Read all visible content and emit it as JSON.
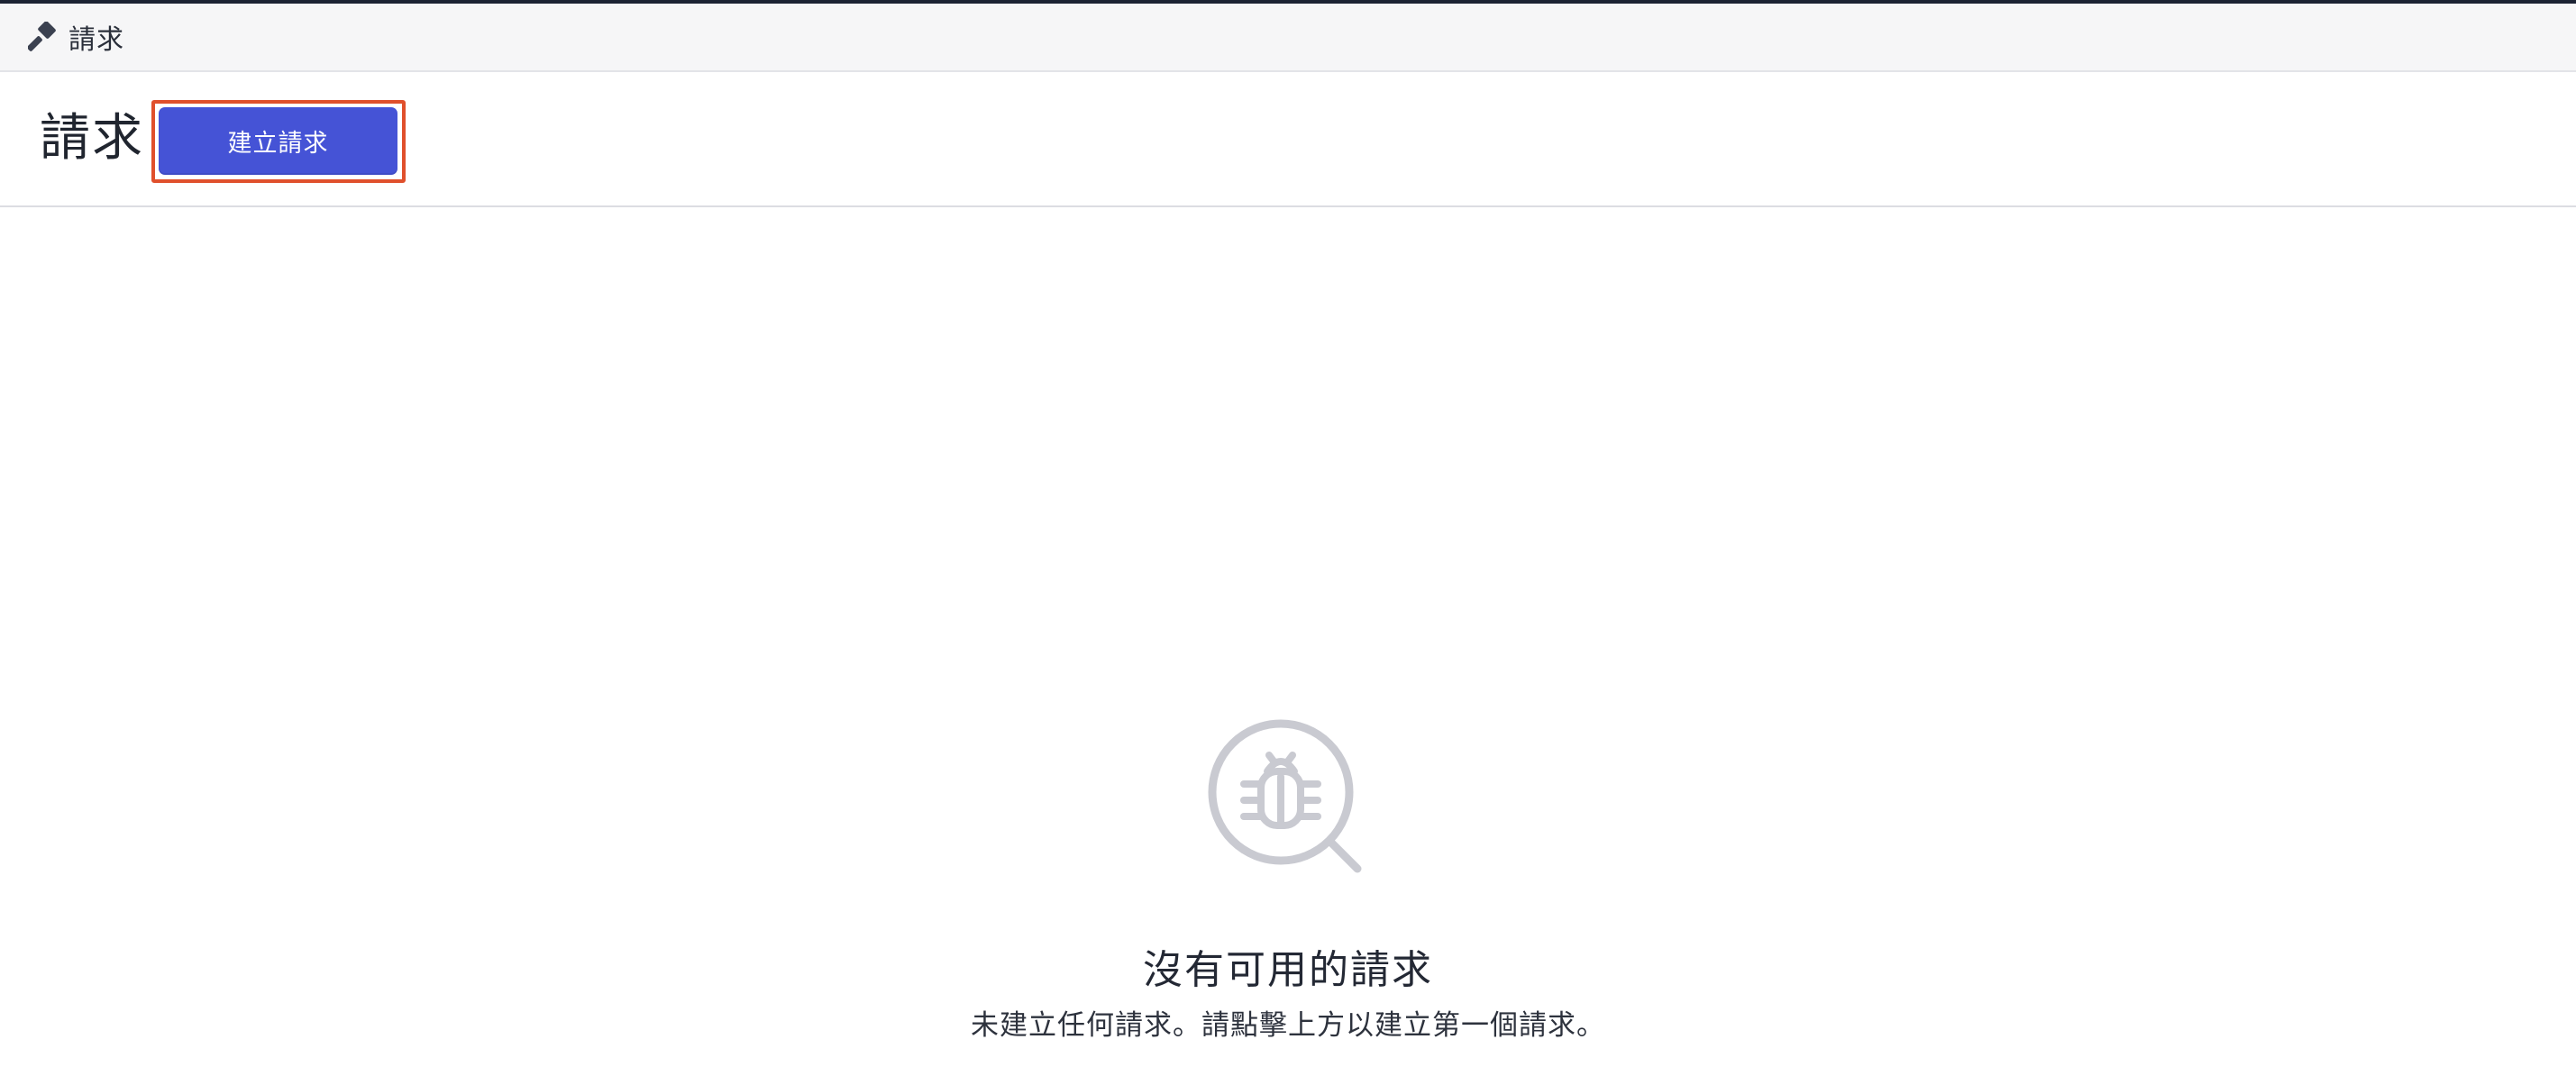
{
  "breadcrumb": {
    "icon": "hammer-icon",
    "label": "請求"
  },
  "header": {
    "title": "請求",
    "create_button_label": "建立請求",
    "highlight_color": "#e0502c",
    "button_color": "#4553d6"
  },
  "empty_state": {
    "icon": "bug-magnifier-icon",
    "title": "沒有可用的請求",
    "description": "未建立任何請求。請點擊上方以建立第一個請求。"
  }
}
